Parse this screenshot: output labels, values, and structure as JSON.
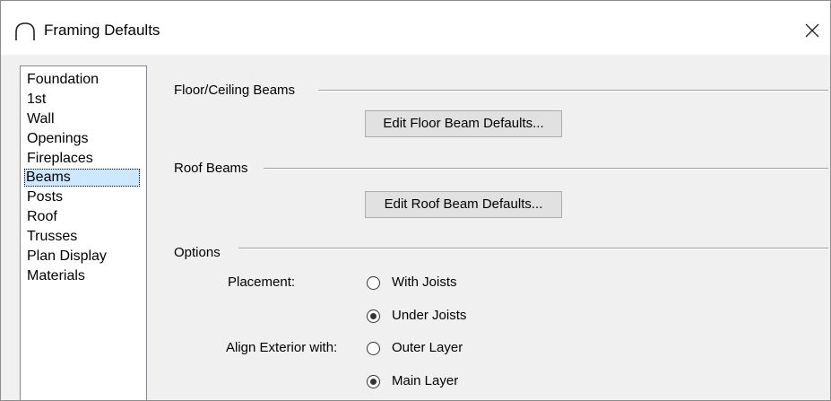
{
  "window": {
    "title": "Framing Defaults",
    "icon": "arch-icon",
    "close_icon": "close-icon"
  },
  "sidebar": {
    "items": [
      {
        "label": "Foundation",
        "selected": false
      },
      {
        "label": "1st",
        "selected": false
      },
      {
        "label": "Wall",
        "selected": false
      },
      {
        "label": "Openings",
        "selected": false
      },
      {
        "label": "Fireplaces",
        "selected": false
      },
      {
        "label": "Beams",
        "selected": true
      },
      {
        "label": "Posts",
        "selected": false
      },
      {
        "label": "Roof",
        "selected": false
      },
      {
        "label": "Trusses",
        "selected": false
      },
      {
        "label": "Plan Display",
        "selected": false
      },
      {
        "label": "Materials",
        "selected": false
      }
    ]
  },
  "floor_ceiling": {
    "title": "Floor/Ceiling Beams",
    "button_label": "Edit Floor Beam Defaults..."
  },
  "roof": {
    "title": "Roof Beams",
    "button_label": "Edit Roof Beam Defaults..."
  },
  "options": {
    "title": "Options",
    "placement": {
      "label": "Placement:",
      "options": [
        {
          "label": "With Joists",
          "checked": false
        },
        {
          "label": "Under Joists",
          "checked": true
        }
      ]
    },
    "align_exterior": {
      "label": "Align Exterior with:",
      "options": [
        {
          "label": "Outer Layer",
          "checked": false
        },
        {
          "label": "Main Layer",
          "checked": true
        }
      ]
    }
  },
  "colors": {
    "selection": "#cce8ff",
    "dialog_bg": "#f0f0f0",
    "button_bg": "#e1e1e1"
  }
}
